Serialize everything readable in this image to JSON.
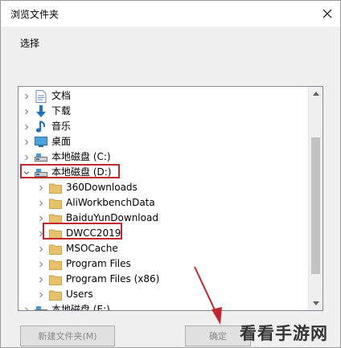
{
  "window": {
    "title": "浏览文件夹"
  },
  "prompt": "选择",
  "tree": {
    "items": [
      {
        "label": "文档",
        "icon": "documents-icon",
        "level": 0
      },
      {
        "label": "下载",
        "icon": "download-icon",
        "level": 0
      },
      {
        "label": "音乐",
        "icon": "music-icon",
        "level": 0
      },
      {
        "label": "桌面",
        "icon": "desktop-icon",
        "level": 0
      },
      {
        "label": "本地磁盘 (C:)",
        "icon": "drive-icon",
        "level": 0
      },
      {
        "label": "本地磁盘 (D:)",
        "icon": "drive-icon",
        "level": 0,
        "expanded": true,
        "highlighted": true
      },
      {
        "label": "360Downloads",
        "icon": "folder-icon",
        "level": 1
      },
      {
        "label": "AliWorkbenchData",
        "icon": "folder-icon",
        "level": 1
      },
      {
        "label": "BaiduYunDownload",
        "icon": "folder-icon",
        "level": 1
      },
      {
        "label": "DWCC2019",
        "icon": "folder-icon",
        "level": 1,
        "highlighted": true
      },
      {
        "label": "MSOCache",
        "icon": "folder-icon",
        "level": 1
      },
      {
        "label": "Program Files",
        "icon": "folder-icon",
        "level": 1
      },
      {
        "label": "Program Files (x86)",
        "icon": "folder-icon",
        "level": 1
      },
      {
        "label": "Users",
        "icon": "folder-icon",
        "level": 1
      },
      {
        "label": "本地磁盘 (E:)",
        "icon": "drive-icon",
        "level": 0
      }
    ]
  },
  "buttons": {
    "new_folder": "新建文件夹(M)",
    "ok": "确定"
  },
  "watermark": "看看手游网",
  "colors": {
    "highlight": "#c4262e",
    "folder": "#e8c26a",
    "accent": "#1e73be"
  }
}
